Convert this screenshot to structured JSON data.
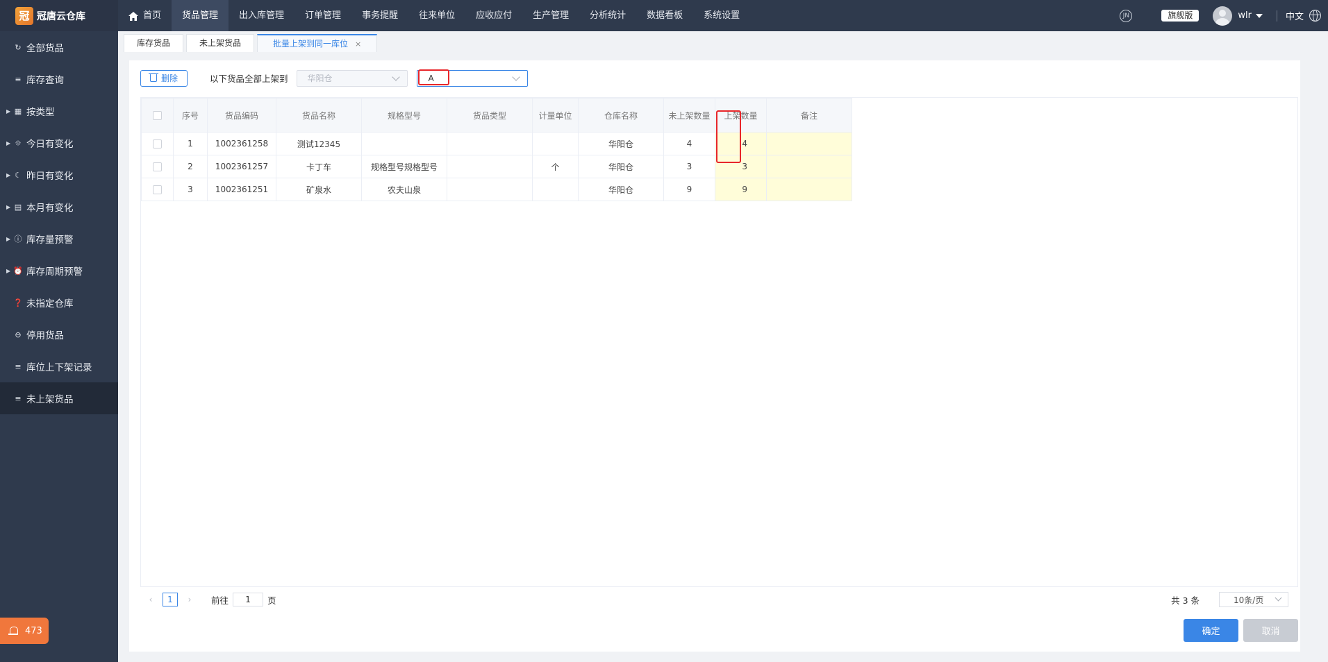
{
  "app": {
    "logo_glyph": "冠",
    "name": "冠唐云仓库"
  },
  "topnav": [
    {
      "label": "首页",
      "icon": "home-icon",
      "active": false
    },
    {
      "label": "货品管理",
      "active": true
    },
    {
      "label": "出入库管理",
      "active": false
    },
    {
      "label": "订单管理",
      "active": false
    },
    {
      "label": "事务提醒",
      "active": false
    },
    {
      "label": "往来单位",
      "active": false
    },
    {
      "label": "应收应付",
      "active": false
    },
    {
      "label": "生产管理",
      "active": false
    },
    {
      "label": "分析统计",
      "active": false
    },
    {
      "label": "数据看板",
      "active": false
    },
    {
      "label": "系统设置",
      "active": false
    }
  ],
  "topright": {
    "circle_icon_text": "JN",
    "edition": "旗舰版",
    "username": "wlr",
    "language": "中文"
  },
  "sidebar": {
    "items": [
      {
        "label": "全部货品",
        "icon": "refresh-icon",
        "glyph": "↻",
        "expandable": false,
        "active": false
      },
      {
        "label": "库存查询",
        "icon": "list-icon",
        "glyph": "≡",
        "expandable": false,
        "active": false
      },
      {
        "label": "按类型",
        "icon": "grid-icon",
        "glyph": "▦",
        "expandable": true,
        "active": false
      },
      {
        "label": "今日有变化",
        "icon": "sun-icon",
        "glyph": "☼",
        "expandable": true,
        "active": false
      },
      {
        "label": "昨日有变化",
        "icon": "sunset-icon",
        "glyph": "☾",
        "expandable": true,
        "active": false
      },
      {
        "label": "本月有变化",
        "icon": "calendar-icon",
        "glyph": "▤",
        "expandable": true,
        "active": false
      },
      {
        "label": "库存量预警",
        "icon": "info-icon",
        "glyph": "ⓘ",
        "expandable": true,
        "active": false
      },
      {
        "label": "库存周期预警",
        "icon": "alarm-clock-icon",
        "glyph": "⏰",
        "expandable": true,
        "active": false
      },
      {
        "label": "未指定仓库",
        "icon": "question-icon",
        "glyph": "❓",
        "expandable": false,
        "active": false
      },
      {
        "label": "停用货品",
        "icon": "minus-circle-icon",
        "glyph": "⊖",
        "expandable": false,
        "active": false
      },
      {
        "label": "库位上下架记录",
        "icon": "list-icon",
        "glyph": "≡",
        "expandable": false,
        "active": false
      },
      {
        "label": "未上架货品",
        "icon": "list-icon",
        "glyph": "≡",
        "expandable": false,
        "active": true
      }
    ],
    "alert_count": "473"
  },
  "tabs": [
    {
      "label": "库存货品",
      "active": false,
      "closable": false
    },
    {
      "label": "未上架货品",
      "active": false,
      "closable": false
    },
    {
      "label": "批量上架到同一库位",
      "active": true,
      "closable": true
    }
  ],
  "toolbar": {
    "delete_label": "删除",
    "target_label": "以下货品全部上架到",
    "warehouse_value": "华阳仓",
    "location_value": "A"
  },
  "table": {
    "columns": [
      "序号",
      "货品编码",
      "货品名称",
      "规格型号",
      "货品类型",
      "计量单位",
      "仓库名称",
      "未上架数量",
      "上架数量",
      "备注"
    ],
    "rows": [
      {
        "index": "1",
        "code": "1002361258",
        "name": "测试12345",
        "spec": "",
        "type": "",
        "unit": "",
        "warehouse": "华阳仓",
        "unshelved": "4",
        "shelve_qty": "4",
        "remark": ""
      },
      {
        "index": "2",
        "code": "1002361257",
        "name": "卡丁车",
        "spec": "规格型号规格型号",
        "type": "",
        "unit": "个",
        "warehouse": "华阳仓",
        "unshelved": "3",
        "shelve_qty": "3",
        "remark": ""
      },
      {
        "index": "3",
        "code": "1002361251",
        "name": "矿泉水",
        "spec": "农夫山泉",
        "type": "",
        "unit": "",
        "warehouse": "华阳仓",
        "unshelved": "9",
        "shelve_qty": "9",
        "remark": ""
      }
    ]
  },
  "pagination": {
    "current_page": "1",
    "goto_prefix": "前往",
    "goto_value": "1",
    "goto_suffix": "页",
    "total": "共 3 条",
    "page_size": "10条/页"
  },
  "footer": {
    "ok_label": "确定",
    "cancel_label": "取消"
  },
  "colors": {
    "accent": "#3a86e6",
    "sidebar_bg": "#2f3a4d",
    "highlight": "#e8262a",
    "editable_cell": "#fffdd9",
    "alert": "#f0773c"
  }
}
